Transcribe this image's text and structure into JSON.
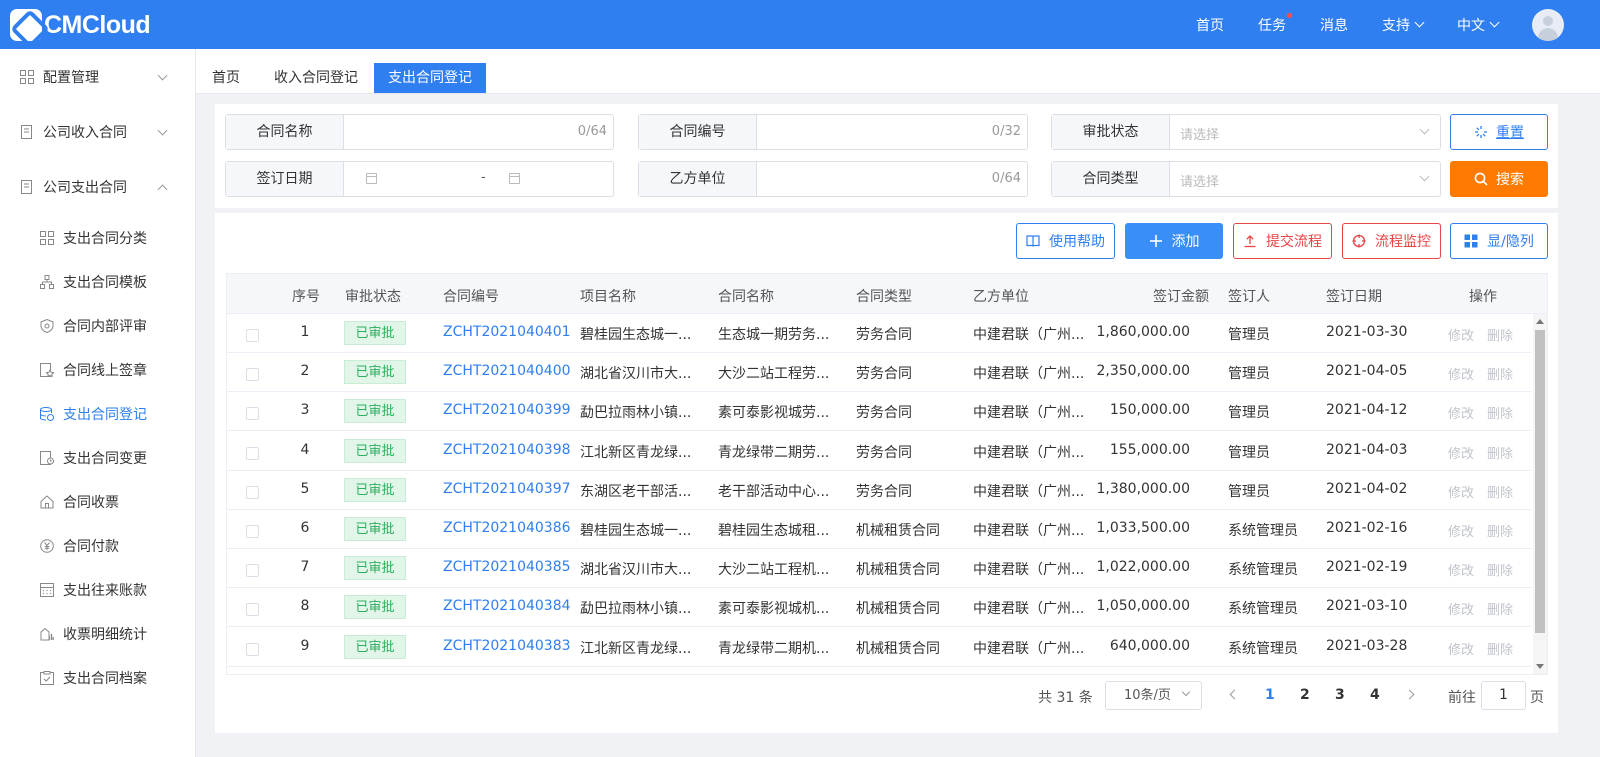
{
  "header": {
    "logo": "CMCloud",
    "nav": [
      {
        "label": "首页"
      },
      {
        "label": "任务",
        "dot": true
      },
      {
        "label": "消息"
      },
      {
        "label": "支持",
        "dropdown": true
      },
      {
        "label": "中文",
        "dropdown": true
      }
    ]
  },
  "sidebar": {
    "groups": [
      "配置管理",
      "公司收入合同",
      "公司支出合同"
    ],
    "items": [
      "支出合同分类",
      "支出合同模板",
      "合同内部评审",
      "合同线上签章",
      "支出合同登记",
      "支出合同变更",
      "合同收票",
      "合同付款",
      "支出往来账款",
      "收票明细统计",
      "支出合同档案"
    ],
    "active_item": "支出合同登记"
  },
  "tabs": [
    "首页",
    "收入合同登记",
    "支出合同登记"
  ],
  "active_tab": "支出合同登记",
  "filters": {
    "contract_name": {
      "label": "合同名称",
      "count": "0/64"
    },
    "contract_no": {
      "label": "合同编号",
      "count": "0/32"
    },
    "approval_status": {
      "label": "审批状态",
      "placeholder": "请选择"
    },
    "sign_date": {
      "label": "签订日期",
      "separator": "-"
    },
    "party_b": {
      "label": "乙方单位",
      "count": "0/64"
    },
    "contract_type": {
      "label": "合同类型",
      "placeholder": "请选择"
    }
  },
  "buttons": {
    "reset": "重置",
    "search": "搜索",
    "help": "使用帮助",
    "add": "添加",
    "submit_flow": "提交流程",
    "monitor_flow": "流程监控",
    "toggle_columns": "显/隐列"
  },
  "table": {
    "columns": [
      "序号",
      "审批状态",
      "合同编号",
      "项目名称",
      "合同名称",
      "合同类型",
      "乙方单位",
      "签订金额",
      "签订人",
      "签订日期",
      "操作"
    ],
    "rows": [
      {
        "no": "1",
        "status": "已审批",
        "code": "ZCHT2021040401",
        "project": "碧桂园生态城一...",
        "name": "生态城一期劳务...",
        "type": "劳务合同",
        "party": "中建君联（广州...",
        "amount": "1,860,000.00",
        "signer": "管理员",
        "date": "2021-03-30"
      },
      {
        "no": "2",
        "status": "已审批",
        "code": "ZCHT2021040400",
        "project": "湖北省汉川市大...",
        "name": "大沙二站工程劳...",
        "type": "劳务合同",
        "party": "中建君联（广州...",
        "amount": "2,350,000.00",
        "signer": "管理员",
        "date": "2021-04-05"
      },
      {
        "no": "3",
        "status": "已审批",
        "code": "ZCHT2021040399",
        "project": "勐巴拉雨林小镇...",
        "name": "素可泰影视城劳...",
        "type": "劳务合同",
        "party": "中建君联（广州...",
        "amount": "150,000.00",
        "signer": "管理员",
        "date": "2021-04-12"
      },
      {
        "no": "4",
        "status": "已审批",
        "code": "ZCHT2021040398",
        "project": "江北新区青龙绿...",
        "name": "青龙绿带二期劳...",
        "type": "劳务合同",
        "party": "中建君联（广州...",
        "amount": "155,000.00",
        "signer": "管理员",
        "date": "2021-04-03"
      },
      {
        "no": "5",
        "status": "已审批",
        "code": "ZCHT2021040397",
        "project": "东湖区老干部活...",
        "name": "老干部活动中心...",
        "type": "劳务合同",
        "party": "中建君联（广州...",
        "amount": "1,380,000.00",
        "signer": "管理员",
        "date": "2021-04-02"
      },
      {
        "no": "6",
        "status": "已审批",
        "code": "ZCHT2021040386",
        "project": "碧桂园生态城一...",
        "name": "碧桂园生态城租...",
        "type": "机械租赁合同",
        "party": "中建君联（广州...",
        "amount": "1,033,500.00",
        "signer": "系统管理员",
        "date": "2021-02-16"
      },
      {
        "no": "7",
        "status": "已审批",
        "code": "ZCHT2021040385",
        "project": "湖北省汉川市大...",
        "name": "大沙二站工程机...",
        "type": "机械租赁合同",
        "party": "中建君联（广州...",
        "amount": "1,022,000.00",
        "signer": "系统管理员",
        "date": "2021-02-19"
      },
      {
        "no": "8",
        "status": "已审批",
        "code": "ZCHT2021040384",
        "project": "勐巴拉雨林小镇...",
        "name": "素可泰影视城机...",
        "type": "机械租赁合同",
        "party": "中建君联（广州...",
        "amount": "1,050,000.00",
        "signer": "系统管理员",
        "date": "2021-03-10"
      },
      {
        "no": "9",
        "status": "已审批",
        "code": "ZCHT2021040383",
        "project": "江北新区青龙绿...",
        "name": "青龙绿带二期机...",
        "type": "机械租赁合同",
        "party": "中建君联（广州...",
        "amount": "640,000.00",
        "signer": "系统管理员",
        "date": "2021-03-28"
      }
    ],
    "actions": {
      "edit": "修改",
      "delete": "删除"
    }
  },
  "pagination": {
    "total": "共 31 条",
    "page_size": "10条/页",
    "pages": [
      "1",
      "2",
      "3",
      "4"
    ],
    "current": "1",
    "goto_prefix": "前往",
    "goto_value": "1",
    "goto_suffix": "页"
  }
}
